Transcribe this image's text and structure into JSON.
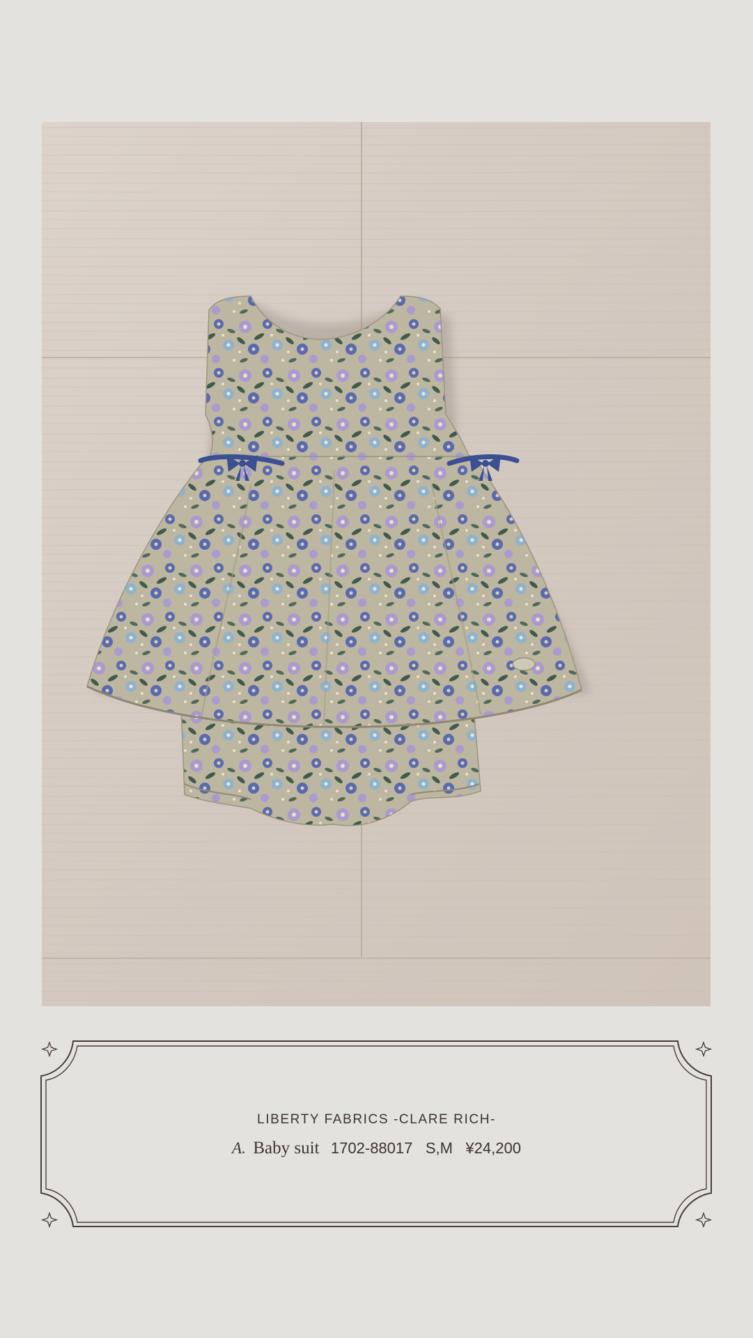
{
  "photo": {
    "alt": "Floral baby suit on a wooden floor",
    "colors": {
      "wood_light": "#d8cfc7",
      "wood_dark": "#c4b8ae",
      "fabric_base": "#b9b39c",
      "flower_blue": "#5a6aae",
      "flower_lilac": "#a99bcf",
      "flower_sky": "#8fb3cf",
      "leaf_green": "#3f5b4c",
      "ribbon": "#3b4f93"
    }
  },
  "caption": {
    "collection": "LIBERTY FABRICS -CLARE RICH-",
    "item_letter": "A.",
    "item_name": "Baby suit",
    "item_code": "1702-88017",
    "item_sizes": "S,M",
    "item_price": "¥24,200",
    "frame_color": "#4a3f37"
  }
}
